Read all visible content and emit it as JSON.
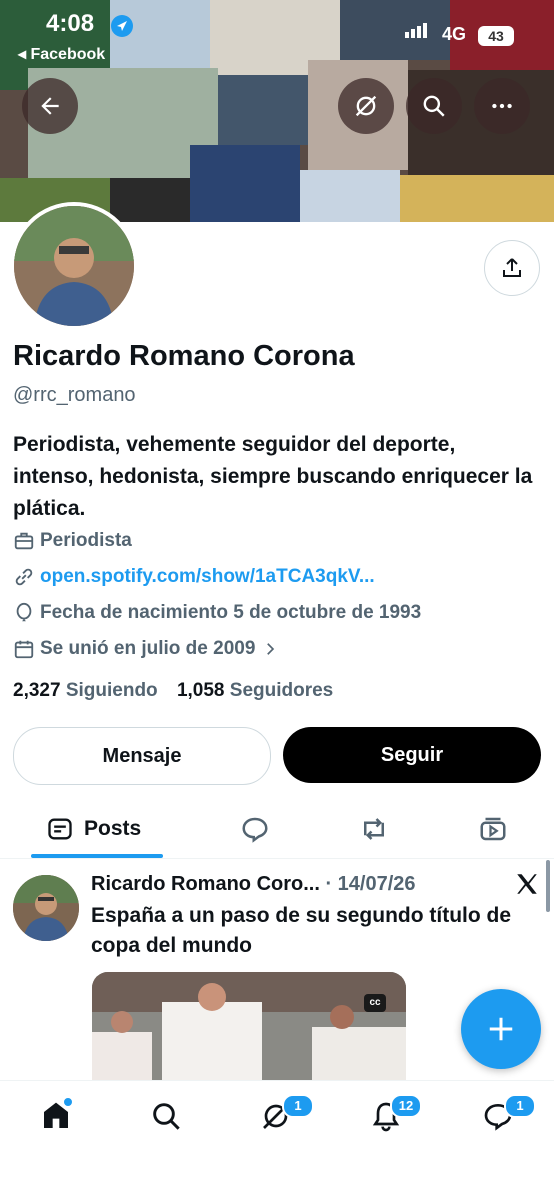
{
  "status_bar": {
    "time": "4:08",
    "back_app": "◂ Facebook",
    "network": "4G",
    "battery": "43"
  },
  "profile": {
    "name": "Ricardo Romano Corona",
    "handle": "@rrc_romano",
    "bio": "Periodista, vehemente seguidor del deporte, intenso, hedonista, siempre buscando enriquecer la plática.",
    "profession": "Periodista",
    "link": "open.spotify.com/show/1aTCA3qkV...",
    "birthday": "Fecha de nacimiento 5 de octubre de 1993",
    "joined": "Se unió en julio de 2009",
    "following_count": "2,327",
    "following_label": "Siguiendo",
    "followers_count": "1,058",
    "followers_label": "Seguidores"
  },
  "actions": {
    "message_label": "Mensaje",
    "follow_label": "Seguir"
  },
  "tabs": [
    {
      "label": "Posts",
      "icon": "posts-icon"
    },
    {
      "label": "",
      "icon": "replies-icon"
    },
    {
      "label": "",
      "icon": "retweets-icon"
    },
    {
      "label": "",
      "icon": "media-icon"
    }
  ],
  "post": {
    "author": "Ricardo Romano Coro...",
    "date": "· 14/07/26",
    "text": "España a un paso de su segundo título de copa del mundo",
    "media_badge": "cc"
  },
  "bottom_nav": {
    "home_icon": "home-icon",
    "search_icon": "search-icon",
    "grok_badge": "1",
    "notifications_badge": "12",
    "messages_badge": "1"
  },
  "colors": {
    "accent": "#1d9bf0",
    "text": "#0f1419",
    "secondary": "#536471"
  }
}
